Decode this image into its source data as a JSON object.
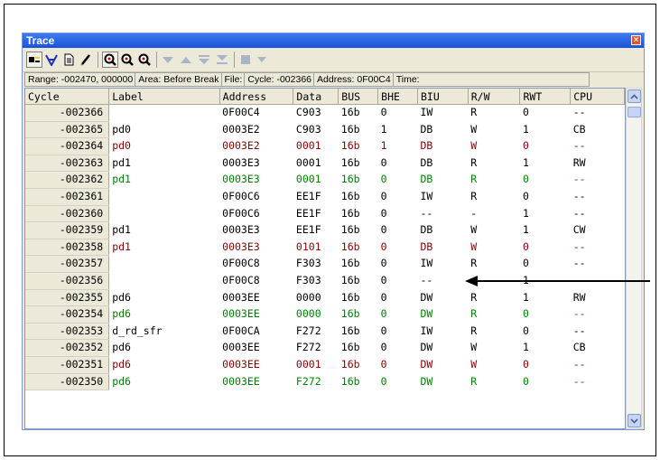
{
  "window": {
    "title": "Trace",
    "close_glyph": "×"
  },
  "toolbar": {
    "icons": [
      "trace-toggle-icon",
      "filter-v-icon",
      "document-icon",
      "pencil-icon",
      "zoom-a-icon",
      "zoom-b-icon",
      "zoom-c-icon",
      "triangle-down-icon",
      "triangle-up-icon",
      "triangle-down-bar-icon",
      "triangle-bar-icon",
      "square-icon",
      "small-triangle-icon"
    ]
  },
  "status": {
    "range_label": "Range:",
    "range_value": "-002470,  000000",
    "area_label": "Area:",
    "area_value": "Before Break",
    "file_label": "File:",
    "cycle_label": "Cycle:",
    "cycle_value": "-002366",
    "address_label": "Address:",
    "address_value": "0F00C4",
    "time_label": "Time:"
  },
  "table": {
    "columns": [
      "Cycle",
      "Label",
      "Address",
      "Data",
      "BUS",
      "BHE",
      "BIU",
      "R/W",
      "RWT",
      "CPU"
    ],
    "rows": [
      {
        "style": "normal",
        "cells": [
          "-002366",
          "",
          "0F00C4",
          "C903",
          "16b",
          "0",
          "IW",
          "R",
          "0",
          "--"
        ]
      },
      {
        "style": "normal",
        "cells": [
          "-002365",
          "pd0",
          "0003E2",
          "C903",
          "16b",
          "1",
          "DB",
          "W",
          "1",
          "CB"
        ]
      },
      {
        "style": "red",
        "cells": [
          "-002364",
          "pd0",
          "0003E2",
          "0001",
          "16b",
          "1",
          "DB",
          "W",
          "0",
          "--"
        ]
      },
      {
        "style": "normal",
        "cells": [
          "-002363",
          "pd1",
          "0003E3",
          "0001",
          "16b",
          "0",
          "DB",
          "R",
          "1",
          "RW"
        ]
      },
      {
        "style": "green",
        "cells": [
          "-002362",
          "pd1",
          "0003E3",
          "0001",
          "16b",
          "0",
          "DB",
          "R",
          "0",
          "--"
        ]
      },
      {
        "style": "normal",
        "cells": [
          "-002361",
          "",
          "0F00C6",
          "EE1F",
          "16b",
          "0",
          "IW",
          "R",
          "0",
          "--"
        ]
      },
      {
        "style": "normal",
        "cells": [
          "-002360",
          "",
          "0F00C6",
          "EE1F",
          "16b",
          "0",
          "--",
          "-",
          "1",
          "--"
        ]
      },
      {
        "style": "normal",
        "cells": [
          "-002359",
          "pd1",
          "0003E3",
          "EE1F",
          "16b",
          "0",
          "DB",
          "W",
          "1",
          "CW"
        ]
      },
      {
        "style": "red",
        "cells": [
          "-002358",
          "pd1",
          "0003E3",
          "0101",
          "16b",
          "0",
          "DB",
          "W",
          "0",
          "--"
        ]
      },
      {
        "style": "normal",
        "cells": [
          "-002357",
          "",
          "0F00C8",
          "F303",
          "16b",
          "0",
          "IW",
          "R",
          "0",
          "--"
        ]
      },
      {
        "style": "normal",
        "cells": [
          "-002356",
          "",
          "0F00C8",
          "F303",
          "16b",
          "0",
          "--",
          "-",
          "1",
          "--"
        ]
      },
      {
        "style": "normal",
        "cells": [
          "-002355",
          "pd6",
          "0003EE",
          "0000",
          "16b",
          "0",
          "DW",
          "R",
          "1",
          "RW"
        ]
      },
      {
        "style": "green",
        "cells": [
          "-002354",
          "pd6",
          "0003EE",
          "0000",
          "16b",
          "0",
          "DW",
          "R",
          "0",
          "--"
        ]
      },
      {
        "style": "normal",
        "cells": [
          "-002353",
          "d_rd_sfr",
          "0F00CA",
          "F272",
          "16b",
          "0",
          "IW",
          "R",
          "0",
          "--"
        ]
      },
      {
        "style": "normal",
        "cells": [
          "-002352",
          "pd6",
          "0003EE",
          "F272",
          "16b",
          "0",
          "DW",
          "W",
          "1",
          "CB"
        ]
      },
      {
        "style": "red",
        "cells": [
          "-002351",
          "pd6",
          "0003EE",
          "0001",
          "16b",
          "0",
          "DW",
          "W",
          "0",
          "--"
        ]
      },
      {
        "style": "green",
        "cells": [
          "-002350",
          "pd6",
          "0003EE",
          "F272",
          "16b",
          "0",
          "DW",
          "R",
          "0",
          "--"
        ]
      }
    ]
  },
  "colors": {
    "title_bar": "#1a53d8",
    "red_row": "#8b0000",
    "green_row": "#008000"
  }
}
